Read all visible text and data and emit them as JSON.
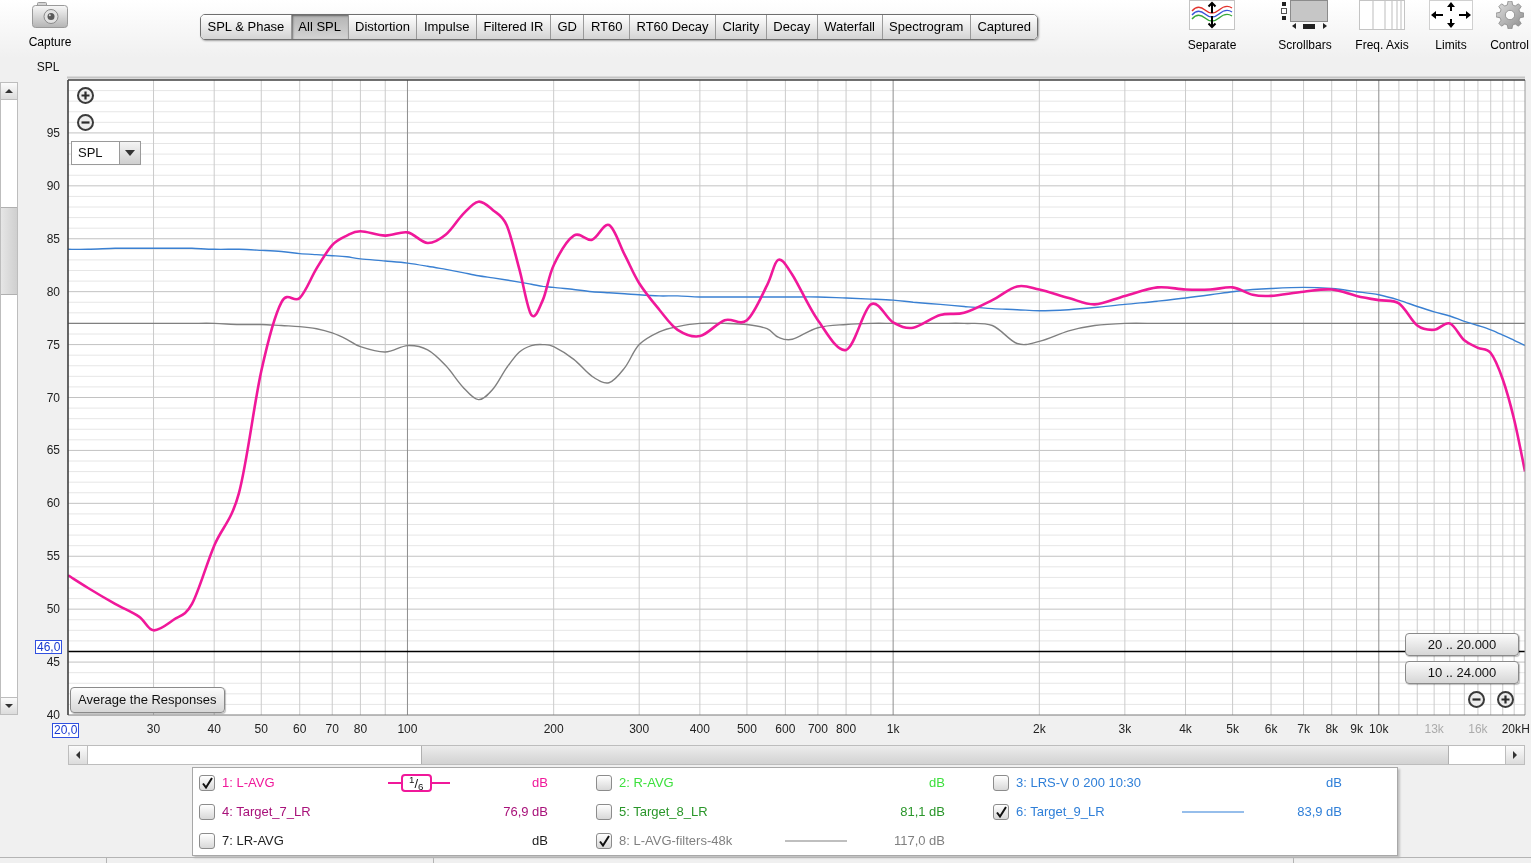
{
  "toolbar": {
    "capture": {
      "label": "Capture"
    },
    "tabs": [
      {
        "label": "SPL & Phase",
        "selected": false
      },
      {
        "label": "All SPL",
        "selected": true
      },
      {
        "label": "Distortion",
        "selected": false
      },
      {
        "label": "Impulse",
        "selected": false
      },
      {
        "label": "Filtered IR",
        "selected": false
      },
      {
        "label": "GD",
        "selected": false
      },
      {
        "label": "RT60",
        "selected": false
      },
      {
        "label": "RT60 Decay",
        "selected": false
      },
      {
        "label": "Clarity",
        "selected": false
      },
      {
        "label": "Decay",
        "selected": false
      },
      {
        "label": "Waterfall",
        "selected": false
      },
      {
        "label": "Spectrogram",
        "selected": false
      },
      {
        "label": "Captured",
        "selected": false
      }
    ],
    "tools": [
      {
        "label": "Separate"
      },
      {
        "label": "Scrollbars"
      },
      {
        "label": "Freq. Axis"
      },
      {
        "label": "Limits"
      },
      {
        "label": "Control"
      }
    ]
  },
  "graph": {
    "chart_data": {
      "type": "line",
      "ylabel": "SPL",
      "xlabel": "H",
      "log": "x",
      "grid": true,
      "xlim": [
        20,
        20000
      ],
      "ylim": [
        40,
        100
      ],
      "x": [
        20,
        22,
        25,
        28,
        30,
        33,
        36,
        40,
        45,
        50,
        55,
        60,
        65,
        70,
        75,
        80,
        90,
        100,
        110,
        120,
        130,
        140,
        150,
        160,
        170,
        180,
        190,
        200,
        220,
        240,
        260,
        280,
        300,
        330,
        360,
        400,
        450,
        500,
        550,
        580,
        620,
        700,
        800,
        900,
        1000,
        1100,
        1250,
        1400,
        1600,
        1800,
        2000,
        2300,
        2600,
        3000,
        3500,
        4000,
        4500,
        5000,
        5500,
        6000,
        7000,
        8000,
        9000,
        10000,
        11000,
        12000,
        13000,
        14000,
        15000,
        16000,
        17000,
        18000,
        19000,
        20000
      ],
      "series": [
        {
          "color": "#f0189a",
          "values": [
            53.2,
            52.0,
            50.5,
            49.3,
            48.0,
            49.0,
            50.5,
            56.0,
            61.0,
            72.5,
            79.0,
            79.4,
            82.2,
            84.4,
            85.3,
            85.7,
            85.3,
            85.6,
            84.6,
            85.4,
            87.3,
            88.5,
            87.7,
            86.3,
            82.1,
            77.8,
            79.2,
            82.5,
            85.3,
            84.9,
            86.3,
            83.5,
            80.8,
            78.3,
            76.4,
            75.8,
            77.3,
            77.3,
            80.6,
            83.0,
            81.6,
            77.3,
            74.5,
            78.8,
            77.1,
            76.6,
            77.8,
            78.0,
            79.2,
            80.5,
            80.2,
            79.4,
            78.8,
            79.6,
            80.4,
            80.2,
            80.2,
            80.4,
            79.7,
            79.6,
            80.0,
            80.2,
            79.6,
            79.2,
            78.9,
            76.8,
            76.4,
            77.0,
            75.4,
            74.7,
            74.2,
            71.7,
            67.9,
            63.0
          ]
        },
        {
          "color": "#3a80d2",
          "values": [
            84.0,
            84.0,
            84.1,
            84.1,
            84.1,
            84.1,
            84.1,
            84.0,
            84.0,
            83.9,
            83.8,
            83.6,
            83.5,
            83.4,
            83.3,
            83.1,
            82.9,
            82.7,
            82.4,
            82.1,
            81.8,
            81.5,
            81.3,
            81.1,
            80.9,
            80.7,
            80.5,
            80.4,
            80.2,
            80.0,
            79.9,
            79.8,
            79.7,
            79.6,
            79.6,
            79.5,
            79.5,
            79.5,
            79.5,
            79.5,
            79.5,
            79.5,
            79.4,
            79.3,
            79.2,
            79.0,
            78.8,
            78.6,
            78.4,
            78.3,
            78.2,
            78.3,
            78.5,
            78.8,
            79.1,
            79.4,
            79.7,
            80.0,
            80.2,
            80.3,
            80.4,
            80.3,
            80.0,
            79.7,
            79.2,
            78.6,
            78.1,
            77.7,
            77.2,
            76.8,
            76.4,
            75.9,
            75.4,
            74.9
          ]
        },
        {
          "color": "#808080",
          "values": [
            77.0,
            77.0,
            77.0,
            77.0,
            77.0,
            77.0,
            77.0,
            77.0,
            76.9,
            76.9,
            76.8,
            76.7,
            76.5,
            76.1,
            75.5,
            74.8,
            74.3,
            74.9,
            74.5,
            73.0,
            71.0,
            69.8,
            70.8,
            72.8,
            74.3,
            74.9,
            75.0,
            74.8,
            73.6,
            72.0,
            71.4,
            72.8,
            75.0,
            76.2,
            76.7,
            77.0,
            77.0,
            76.9,
            76.5,
            75.7,
            75.5,
            76.6,
            76.9,
            77.0,
            77.0,
            77.0,
            77.0,
            77.0,
            76.8,
            75.1,
            75.3,
            76.3,
            76.8,
            77.0,
            77.0,
            77.0,
            77.0,
            77.0,
            77.0,
            77.0,
            77.0,
            77.0,
            77.0,
            77.0,
            77.0,
            77.0,
            77.0,
            77.0,
            77.0,
            77.0,
            77.0,
            77.0,
            77.0,
            77.0
          ]
        }
      ],
      "xticks": [
        {
          "value": 30,
          "label": "30"
        },
        {
          "value": 40,
          "label": "40"
        },
        {
          "value": 50,
          "label": "50"
        },
        {
          "value": 60,
          "label": "60"
        },
        {
          "value": 70,
          "label": "70"
        },
        {
          "value": 80,
          "label": "80"
        },
        {
          "value": 100,
          "label": "100"
        },
        {
          "value": 200,
          "label": "200"
        },
        {
          "value": 300,
          "label": "300"
        },
        {
          "value": 400,
          "label": "400"
        },
        {
          "value": 500,
          "label": "500"
        },
        {
          "value": 600,
          "label": "600"
        },
        {
          "value": 700,
          "label": "700"
        },
        {
          "value": 800,
          "label": "800"
        },
        {
          "value": 1000,
          "label": "1k"
        },
        {
          "value": 2000,
          "label": "2k"
        },
        {
          "value": 3000,
          "label": "3k"
        },
        {
          "value": 4000,
          "label": "4k"
        },
        {
          "value": 5000,
          "label": "5k"
        },
        {
          "value": 6000,
          "label": "6k"
        },
        {
          "value": 7000,
          "label": "7k"
        },
        {
          "value": 8000,
          "label": "8k"
        },
        {
          "value": 9000,
          "label": "9k"
        },
        {
          "value": 10000,
          "label": "10k"
        },
        {
          "value": 13000,
          "label": "13k"
        },
        {
          "value": 16000,
          "label": "16k"
        },
        {
          "value": 20000,
          "label": "20k"
        }
      ],
      "yticks": [
        40,
        45,
        50,
        55,
        60,
        65,
        70,
        75,
        80,
        85,
        90,
        95
      ],
      "ref_lines": [
        {
          "axis": "y",
          "value": 46
        }
      ]
    },
    "measure_select": {
      "value": "SPL"
    },
    "cursor": {
      "x_readout": "20,0",
      "y_readout": "46,0"
    },
    "average_button": "Average the Responses",
    "range_buttons": [
      "20 .. 20.000",
      "10 .. 24.000"
    ]
  },
  "legend": [
    {
      "label": "1: L-AVG",
      "color": "#f0189a",
      "checked": true,
      "smoothing": "$^{1}$/$_{6}$",
      "value": "dB"
    },
    {
      "label": "2: R-AVG",
      "color": "#3ee03e",
      "checked": false,
      "value": "dB"
    },
    {
      "label": "3: LRS-V 0 200 10:30",
      "color": "#2f7fd8",
      "checked": false,
      "value": "dB"
    },
    {
      "label": "4: Target_7_LR",
      "color": "#a8127a",
      "checked": false,
      "value": "76,9 dB"
    },
    {
      "label": "5: Target_8_LR",
      "color": "#2a962a",
      "checked": false,
      "value": "81,1 dB"
    },
    {
      "label": "6: Target_9_LR",
      "color": "#2f7fd8",
      "checked": true,
      "value": "83,9 dB"
    },
    {
      "label": "7: LR-AVG",
      "color": "#1e1e1e",
      "checked": false,
      "value": "dB"
    },
    {
      "label": "8: L-AVG-filters-48k",
      "color": "#808080",
      "checked": true,
      "value": "117,0 dB"
    }
  ]
}
